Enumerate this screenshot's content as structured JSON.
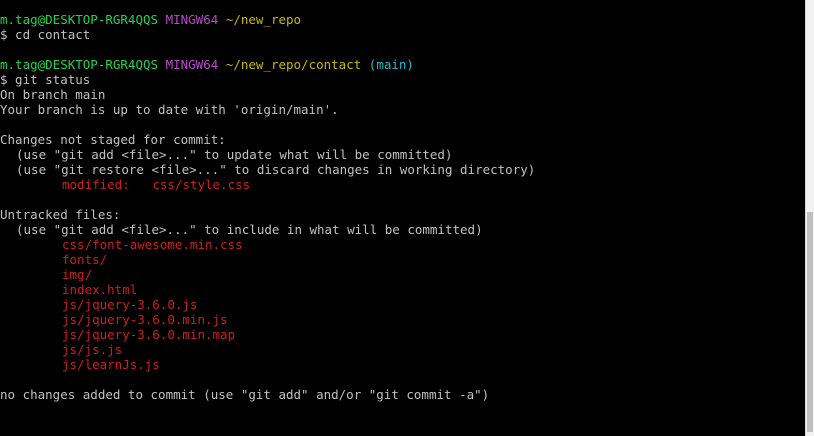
{
  "prompt1": {
    "user_host": "m.tag@DESKTOP-RGR4QQS",
    "system": "MINGW64",
    "path": "~/new_repo"
  },
  "cmd1": "$ cd contact",
  "prompt2": {
    "user_host": "m.tag@DESKTOP-RGR4QQS",
    "system": "MINGW64",
    "path": "~/new_repo/contact",
    "branch": "(main)"
  },
  "cmd2": "$ git status",
  "status": {
    "on_branch": "On branch main",
    "up_to_date": "Your branch is up to date with 'origin/main'.",
    "not_staged_header": "Changes not staged for commit:",
    "hint_add": "(use \"git add <file>...\" to update what will be committed)",
    "hint_restore": "(use \"git restore <file>...\" to discard changes in working directory)",
    "modified_label": "modified:",
    "modified_file": "css/style.css",
    "untracked_header": "Untracked files:",
    "hint_untracked": "(use \"git add <file>...\" to include in what will be committed)",
    "untracked": [
      "css/font-awesome.min.css",
      "fonts/",
      "img/",
      "index.html",
      "js/jquery-3.6.0.js",
      "js/jquery-3.6.0.min.js",
      "js/jquery-3.6.0.min.map",
      "js/js.js",
      "js/learnJs.js"
    ],
    "footer": "no changes added to commit (use \"git add\" and/or \"git commit -a\")"
  },
  "colors": {
    "user": "#23d14f",
    "system": "#b84ac9",
    "path": "#c8b700",
    "branch": "#21b7c4",
    "red": "#cc1f1f",
    "text": "#c0c0c0",
    "background": "#000000"
  }
}
